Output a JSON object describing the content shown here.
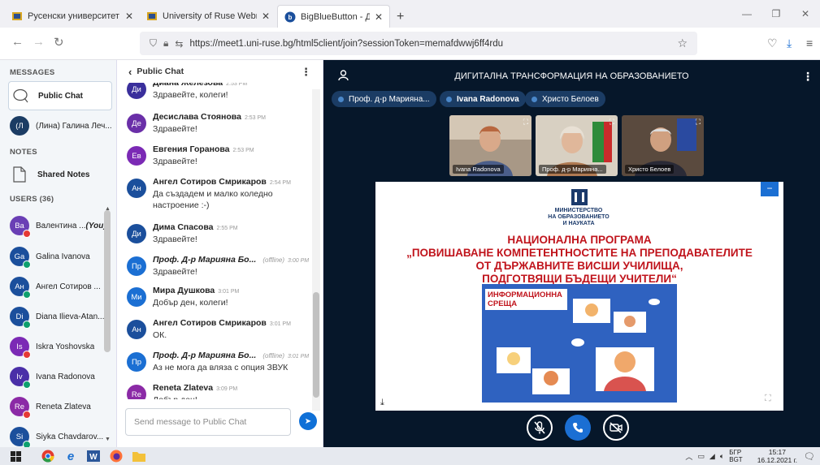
{
  "browser": {
    "tabs": [
      {
        "title": "Русенски университет",
        "active": false
      },
      {
        "title": "University of Ruse Webmail :: R",
        "active": false
      },
      {
        "title": "BigBlueButton - ДИГИТАЛНА Т",
        "active": true
      }
    ],
    "url": "https://meet1.uni-ruse.bg/html5client/join?sessionToken=memafdwwj6ff4rdu"
  },
  "userlist": {
    "messages_heading": "MESSAGES",
    "public_chat": "Public Chat",
    "private_chat": {
      "initials": "(Л",
      "name": "(Лина) Галина Леч..."
    },
    "notes_heading": "NOTES",
    "shared_notes": "Shared Notes",
    "users_heading": "USERS (36)",
    "users": [
      {
        "initials": "Ва",
        "name": "Валентина ...",
        "suffix": "(You)",
        "color": "#6a3fb5",
        "status": "muted"
      },
      {
        "initials": "Ga",
        "name": "Galina Ivanova",
        "suffix": "",
        "color": "#1b4f9c",
        "status": "on"
      },
      {
        "initials": "Ан",
        "name": "Ангел Сотиров ...",
        "suffix": "",
        "color": "#1b4f9c",
        "status": "on"
      },
      {
        "initials": "Di",
        "name": "Diana Ilieva-Atan...",
        "suffix": "",
        "color": "#1b4f9c",
        "status": "on"
      },
      {
        "initials": "Is",
        "name": "Iskra Yoshovska",
        "suffix": "",
        "color": "#7b2ab5",
        "status": "muted"
      },
      {
        "initials": "Iv",
        "name": "Ivana Radonova",
        "suffix": "",
        "color": "#4a2fa8",
        "status": "on"
      },
      {
        "initials": "Re",
        "name": "Reneta Zlateva",
        "suffix": "",
        "color": "#8b2aa6",
        "status": "muted"
      },
      {
        "initials": "Si",
        "name": "Siyka Chavdarov...",
        "suffix": "",
        "color": "#1b4f9c",
        "status": "on"
      }
    ]
  },
  "chat": {
    "header": "Public Chat",
    "back_glyph": "‹",
    "input_placeholder": "Send message to Public Chat",
    "messages": [
      {
        "initials": "Ди",
        "color": "#3a2f9c",
        "name": "Диана Железова",
        "time": "2:53 PM",
        "offline": "",
        "italic": false,
        "text": "Здравейте, колеги!"
      },
      {
        "initials": "Де",
        "color": "#6a2fa8",
        "name": "Десислава Стоянова",
        "time": "2:53 PM",
        "offline": "",
        "italic": false,
        "text": "Здравейте!"
      },
      {
        "initials": "Ев",
        "color": "#7b2ab5",
        "name": "Евгения Горанова",
        "time": "2:53 PM",
        "offline": "",
        "italic": false,
        "text": "Здравейте!"
      },
      {
        "initials": "Ан",
        "color": "#1b4f9c",
        "name": "Ангел Сотиров Смрикаров",
        "time": "2:54 PM",
        "offline": "",
        "italic": false,
        "text": "Да създадем и малко коледно настроение :-)"
      },
      {
        "initials": "Ди",
        "color": "#1b4f9c",
        "name": "Дима Спасова",
        "time": "2:55 PM",
        "offline": "",
        "italic": false,
        "text": "Здравейте!"
      },
      {
        "initials": "Пр",
        "color": "#1b6fd3",
        "name": "Проф. Д-р Марияна Бо...",
        "time": "3:00 PM",
        "offline": "(offline)",
        "italic": true,
        "text": "Здравейте!"
      },
      {
        "initials": "Ми",
        "color": "#1b6fd3",
        "name": "Мира Душкова",
        "time": "3:01 PM",
        "offline": "",
        "italic": false,
        "text": "Добър ден, колеги!"
      },
      {
        "initials": "Ан",
        "color": "#1b4f9c",
        "name": "Ангел Сотиров Смрикаров",
        "time": "3:01 PM",
        "offline": "",
        "italic": false,
        "text": "ОК."
      },
      {
        "initials": "Пр",
        "color": "#1b6fd3",
        "name": "Проф. Д-р Марияна Бо...",
        "time": "3:01 PM",
        "offline": "(offline)",
        "italic": true,
        "text": "Аз не мога да вляза с опция ЗВУК"
      },
      {
        "initials": "Re",
        "color": "#8b2aa6",
        "name": "Reneta Zlateva",
        "time": "3:09 PM",
        "offline": "",
        "italic": false,
        "text": "Добър ден!"
      }
    ]
  },
  "meeting": {
    "title": "ДИГИТАЛНА ТРАНСФОРМАЦИЯ НА ОБРАЗОВАНИЕТО",
    "talkers": [
      "Проф. д-р Марияна...",
      "Ivana Radonova",
      "Христо Белоев"
    ],
    "videos": [
      {
        "label": "Ivana Radonova",
        "bg": "#9a8a7a"
      },
      {
        "label": "Проф. д-р Марияна...",
        "bg": "#c9b49a"
      },
      {
        "label": "Христо Белоев",
        "bg": "#6a5a4c"
      }
    ]
  },
  "slide": {
    "org_line1": "МИНИСТЕРСТВО",
    "org_line2": "НА ОБРАЗОВАНИЕТО",
    "org_line3": "И НАУКАТА",
    "title_line1": "НАЦИОНАЛНА ПРОГРАМА",
    "title_line2": "„ПОВИШАВАНЕ КОМПЕТЕНТНОСТИТЕ НА ПРЕПОДАВАТЕЛИТЕ",
    "title_line3": "ОТ ДЪРЖАВНИТЕ ВИСШИ УЧИЛИЩА,",
    "title_line4": "ПОДГОТВЯЩИ БЪДЕЩИ УЧИТЕЛИ“",
    "info_line1": "ИНФОРМАЦИОННА",
    "info_line2": "СРЕЩА"
  },
  "taskbar": {
    "lang_line1": "БГР",
    "lang_line2": "BGT",
    "time": "15:17",
    "date": "16.12.2021 г."
  }
}
